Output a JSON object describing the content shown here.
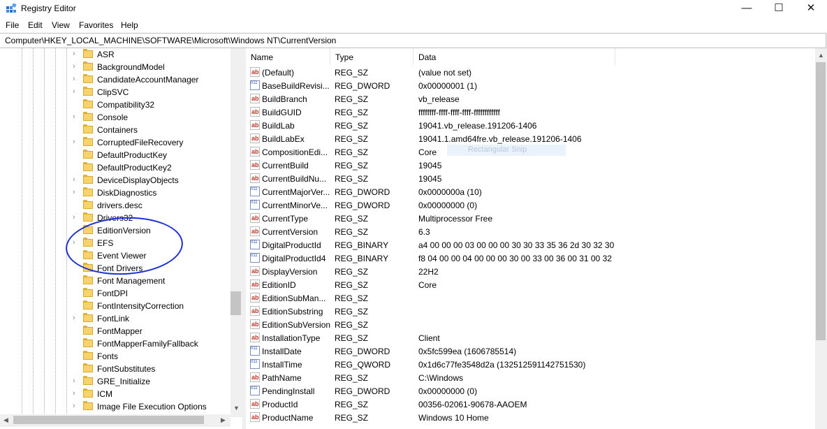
{
  "window": {
    "title": "Registry Editor",
    "minimize": "—",
    "maximize": "☐",
    "close": "✕"
  },
  "menu": [
    "File",
    "Edit",
    "View",
    "Favorites",
    "Help"
  ],
  "address": "Computer\\HKEY_LOCAL_MACHINE\\SOFTWARE\\Microsoft\\Windows NT\\CurrentVersion",
  "tree": {
    "items": [
      {
        "label": "ASR",
        "expandable": true
      },
      {
        "label": "BackgroundModel",
        "expandable": true
      },
      {
        "label": "CandidateAccountManager",
        "expandable": true
      },
      {
        "label": "ClipSVC",
        "expandable": true
      },
      {
        "label": "Compatibility32",
        "expandable": false
      },
      {
        "label": "Console",
        "expandable": true
      },
      {
        "label": "Containers",
        "expandable": false
      },
      {
        "label": "CorruptedFileRecovery",
        "expandable": true
      },
      {
        "label": "DefaultProductKey",
        "expandable": false
      },
      {
        "label": "DefaultProductKey2",
        "expandable": false
      },
      {
        "label": "DeviceDisplayObjects",
        "expandable": true
      },
      {
        "label": "DiskDiagnostics",
        "expandable": true
      },
      {
        "label": "drivers.desc",
        "expandable": false
      },
      {
        "label": "Drivers32",
        "expandable": true
      },
      {
        "label": "EditionVersion",
        "expandable": false
      },
      {
        "label": "EFS",
        "expandable": true
      },
      {
        "label": "Event Viewer",
        "expandable": false
      },
      {
        "label": "Font Drivers",
        "expandable": false
      },
      {
        "label": "Font Management",
        "expandable": false
      },
      {
        "label": "FontDPI",
        "expandable": false
      },
      {
        "label": "FontIntensityCorrection",
        "expandable": false
      },
      {
        "label": "FontLink",
        "expandable": true
      },
      {
        "label": "FontMapper",
        "expandable": false
      },
      {
        "label": "FontMapperFamilyFallback",
        "expandable": false
      },
      {
        "label": "Fonts",
        "expandable": false
      },
      {
        "label": "FontSubstitutes",
        "expandable": false
      },
      {
        "label": "GRE_Initialize",
        "expandable": true
      },
      {
        "label": "ICM",
        "expandable": true
      },
      {
        "label": "Image File Execution Options",
        "expandable": true
      }
    ]
  },
  "columns": {
    "name": "Name",
    "type": "Type",
    "data": "Data"
  },
  "values": [
    {
      "icon": "sz",
      "name": "(Default)",
      "type": "REG_SZ",
      "data": "(value not set)"
    },
    {
      "icon": "bin",
      "name": "BaseBuildRevisi...",
      "type": "REG_DWORD",
      "data": "0x00000001 (1)"
    },
    {
      "icon": "sz",
      "name": "BuildBranch",
      "type": "REG_SZ",
      "data": "vb_release"
    },
    {
      "icon": "sz",
      "name": "BuildGUID",
      "type": "REG_SZ",
      "data": "ffffffff-ffff-ffff-ffff-ffffffffffff"
    },
    {
      "icon": "sz",
      "name": "BuildLab",
      "type": "REG_SZ",
      "data": "19041.vb_release.191206-1406"
    },
    {
      "icon": "sz",
      "name": "BuildLabEx",
      "type": "REG_SZ",
      "data": "19041.1.amd64fre.vb_release.191206-1406"
    },
    {
      "icon": "sz",
      "name": "CompositionEdi...",
      "type": "REG_SZ",
      "data": "Core"
    },
    {
      "icon": "sz",
      "name": "CurrentBuild",
      "type": "REG_SZ",
      "data": "19045"
    },
    {
      "icon": "sz",
      "name": "CurrentBuildNu...",
      "type": "REG_SZ",
      "data": "19045"
    },
    {
      "icon": "bin",
      "name": "CurrentMajorVer...",
      "type": "REG_DWORD",
      "data": "0x0000000a (10)"
    },
    {
      "icon": "bin",
      "name": "CurrentMinorVe...",
      "type": "REG_DWORD",
      "data": "0x00000000 (0)"
    },
    {
      "icon": "sz",
      "name": "CurrentType",
      "type": "REG_SZ",
      "data": "Multiprocessor Free"
    },
    {
      "icon": "sz",
      "name": "CurrentVersion",
      "type": "REG_SZ",
      "data": "6.3"
    },
    {
      "icon": "bin",
      "name": "DigitalProductId",
      "type": "REG_BINARY",
      "data": "a4 00 00 00 03 00 00 00 30 30 33 35 36 2d 30 32 30 3..."
    },
    {
      "icon": "bin",
      "name": "DigitalProductId4",
      "type": "REG_BINARY",
      "data": "f8 04 00 00 04 00 00 00 30 00 33 00 36 00 31 00 32 00..."
    },
    {
      "icon": "sz",
      "name": "DisplayVersion",
      "type": "REG_SZ",
      "data": "22H2"
    },
    {
      "icon": "sz",
      "name": "EditionID",
      "type": "REG_SZ",
      "data": "Core"
    },
    {
      "icon": "sz",
      "name": "EditionSubMan...",
      "type": "REG_SZ",
      "data": ""
    },
    {
      "icon": "sz",
      "name": "EditionSubstring",
      "type": "REG_SZ",
      "data": ""
    },
    {
      "icon": "sz",
      "name": "EditionSubVersion",
      "type": "REG_SZ",
      "data": ""
    },
    {
      "icon": "sz",
      "name": "InstallationType",
      "type": "REG_SZ",
      "data": "Client"
    },
    {
      "icon": "bin",
      "name": "InstallDate",
      "type": "REG_DWORD",
      "data": "0x5fc599ea (1606785514)"
    },
    {
      "icon": "bin",
      "name": "InstallTime",
      "type": "REG_QWORD",
      "data": "0x1d6c77fe3548d2a (132512591142751530)"
    },
    {
      "icon": "sz",
      "name": "PathName",
      "type": "REG_SZ",
      "data": "C:\\Windows"
    },
    {
      "icon": "bin",
      "name": "PendingInstall",
      "type": "REG_DWORD",
      "data": "0x00000000 (0)"
    },
    {
      "icon": "sz",
      "name": "ProductId",
      "type": "REG_SZ",
      "data": "00356-02061-90678-AAOEM"
    },
    {
      "icon": "sz",
      "name": "ProductName",
      "type": "REG_SZ",
      "data": "Windows 10 Home"
    }
  ],
  "overlay_ghost": "Rectangular Snip"
}
